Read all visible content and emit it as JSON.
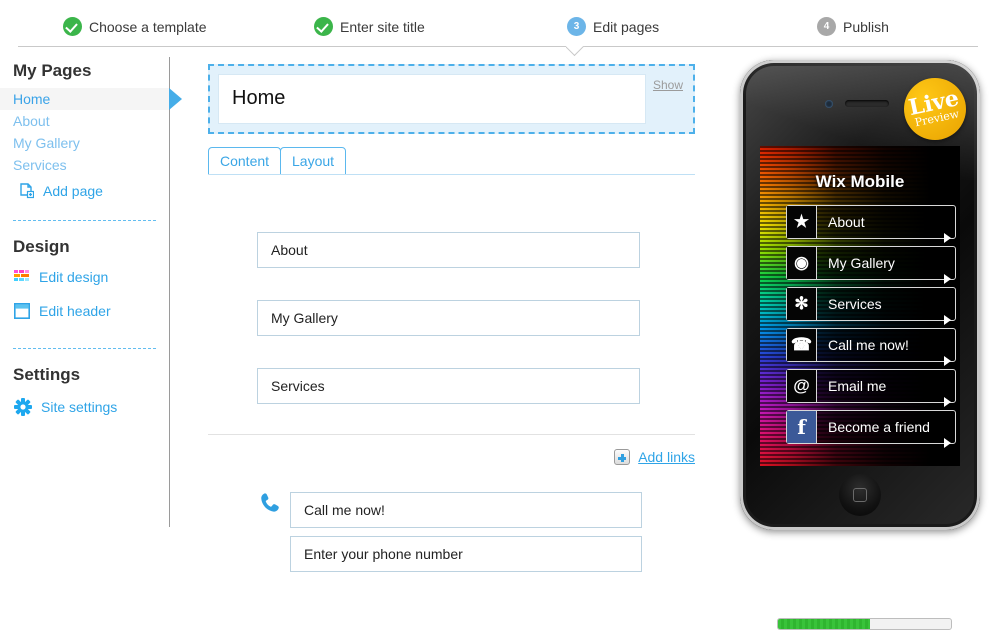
{
  "wizard": {
    "steps": [
      {
        "badge": "check-icon",
        "label": "Choose a template",
        "state": "done"
      },
      {
        "badge": "check-icon",
        "label": "Enter site title",
        "state": "done"
      },
      {
        "badge": "3",
        "label": "Edit pages",
        "state": "active"
      },
      {
        "badge": "4",
        "label": "Publish",
        "state": "todo"
      }
    ],
    "active_color": "#6cb5e8",
    "done_color": "#3bb54a",
    "todo_color": "#a8a8a8"
  },
  "sidebar": {
    "pages_heading": "My Pages",
    "pages": [
      {
        "label": "Home",
        "selected": true
      },
      {
        "label": "About",
        "selected": false
      },
      {
        "label": "My Gallery",
        "selected": false
      },
      {
        "label": "Services",
        "selected": false
      }
    ],
    "add_page_label": "Add page",
    "design_heading": "Design",
    "edit_design_label": "Edit design",
    "edit_header_label": "Edit header",
    "settings_heading": "Settings",
    "site_settings_label": "Site settings",
    "link_color": "#2fa4e7"
  },
  "main": {
    "page_title_value": "Home",
    "show_label": "Show",
    "tabs": [
      {
        "label": "Content",
        "active": true
      },
      {
        "label": "Layout",
        "active": false
      }
    ],
    "links": [
      {
        "label": "About"
      },
      {
        "label": "My Gallery"
      },
      {
        "label": "Services"
      }
    ],
    "add_links_label": "Add links",
    "call_title_value": "Call me now!",
    "phone_number_value": "Enter your phone number"
  },
  "preview": {
    "live_badge_line1": "Live",
    "live_badge_line2": "Preview",
    "site_title": "Wix Mobile",
    "menu": [
      {
        "icon": "star-icon",
        "glyph": "★",
        "label": "About"
      },
      {
        "icon": "camera-icon",
        "glyph": "◉",
        "label": "My Gallery"
      },
      {
        "icon": "gear-icon",
        "glyph": "✻",
        "label": "Services"
      },
      {
        "icon": "phone-icon",
        "glyph": "☎",
        "label": "Call me now!"
      },
      {
        "icon": "at-icon",
        "glyph": "@",
        "label": "Email me"
      },
      {
        "icon": "facebook-icon",
        "glyph": "f",
        "label": "Become a friend"
      }
    ],
    "progress_percent": 53
  }
}
